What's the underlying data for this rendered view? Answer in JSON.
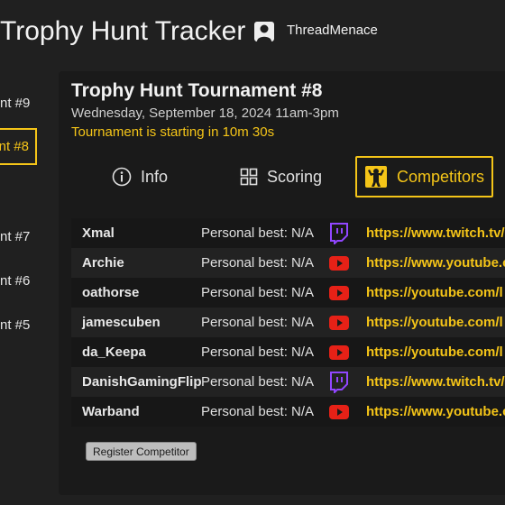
{
  "app": {
    "title": "Trophy Hunt Tracker",
    "username": "ThreadMenace"
  },
  "sidebar": {
    "items": [
      {
        "label": "nt #9",
        "active": false
      },
      {
        "label": "nt #8",
        "active": true
      },
      {
        "label": "nt #7",
        "active": false
      },
      {
        "label": "nt #6",
        "active": false
      },
      {
        "label": "nt #5",
        "active": false
      }
    ]
  },
  "tournament": {
    "title": "Trophy Hunt Tournament #8",
    "date": "Wednesday, September 18, 2024 11am-3pm",
    "status": "Tournament is starting in 10m 30s"
  },
  "tabs": [
    {
      "label": "Info",
      "icon": "info-icon"
    },
    {
      "label": "Scoring",
      "icon": "grid-icon"
    },
    {
      "label": "Competitors",
      "icon": "strongman-icon",
      "active": true
    }
  ],
  "competitors": [
    {
      "name": "Xmal",
      "pb": "Personal best: N/A",
      "platform": "twitch",
      "url": "https://www.twitch.tv/"
    },
    {
      "name": "Archie",
      "pb": "Personal best: N/A",
      "platform": "youtube",
      "url": "https://www.youtube.c"
    },
    {
      "name": "oathorse",
      "pb": "Personal best: N/A",
      "platform": "youtube",
      "url": "https://youtube.com/l"
    },
    {
      "name": "jamescuben",
      "pb": "Personal best: N/A",
      "platform": "youtube",
      "url": "https://youtube.com/l"
    },
    {
      "name": "da_Keepa",
      "pb": "Personal best: N/A",
      "platform": "youtube",
      "url": "https://youtube.com/l"
    },
    {
      "name": "DanishGamingFlip",
      "pb": "Personal best: N/A",
      "platform": "twitch",
      "url": "https://www.twitch.tv/"
    },
    {
      "name": "Warband",
      "pb": "Personal best: N/A",
      "platform": "youtube",
      "url": "https://www.youtube.c"
    }
  ],
  "actions": {
    "register_label": "Register Competitor"
  },
  "colors": {
    "accent": "#f5c518",
    "twitch": "#9146ff",
    "youtube": "#e62117",
    "background": "#202020"
  }
}
